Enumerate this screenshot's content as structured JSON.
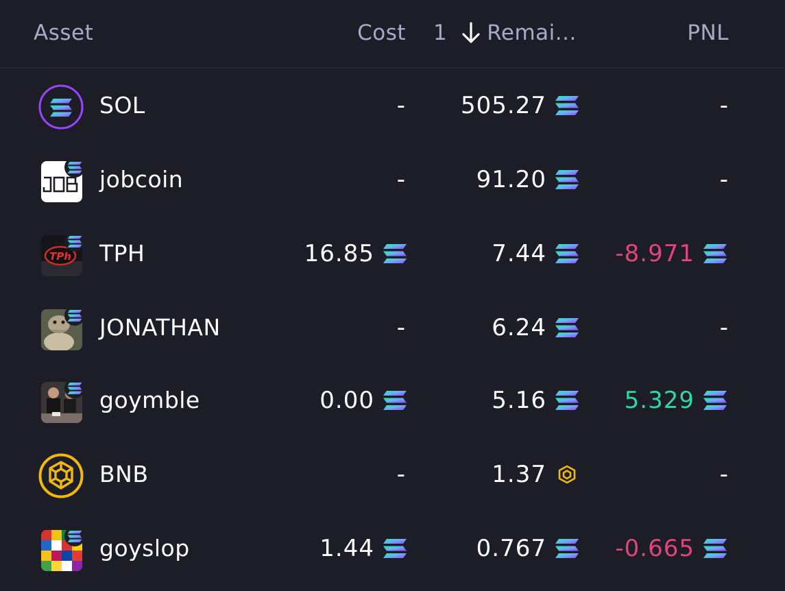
{
  "header": {
    "asset_label": "Asset",
    "cost_label": "Cost",
    "sort_number": "1",
    "remaining_label": "Remai...",
    "pnl_label": "PNL"
  },
  "colors": {
    "background": "#1c1d26",
    "header_text": "#a8aac7",
    "negative": "#e0457b",
    "positive": "#2fd8a5",
    "bnb": "#f0b90b",
    "sol_purple": "#9945ff"
  },
  "rows": [
    {
      "name": "SOL",
      "avatar": "sol-logo",
      "cost": "-",
      "remaining": "505.27",
      "remaining_unit": "sol-icon",
      "pnl": "-",
      "pnl_sign": "none"
    },
    {
      "name": "jobcoin",
      "avatar": "jobcoin-logo",
      "cost": "-",
      "remaining": "91.20",
      "remaining_unit": "sol-icon",
      "pnl": "-",
      "pnl_sign": "none"
    },
    {
      "name": "TPH",
      "avatar": "tph-logo",
      "cost": "16.85",
      "remaining": "7.44",
      "remaining_unit": "sol-icon",
      "pnl": "-8.971",
      "pnl_sign": "negative"
    },
    {
      "name": "JONATHAN",
      "avatar": "jonathan-logo",
      "cost": "-",
      "remaining": "6.24",
      "remaining_unit": "sol-icon",
      "pnl": "-",
      "pnl_sign": "none"
    },
    {
      "name": "goymble",
      "avatar": "goymble-logo",
      "cost": "0.00",
      "remaining": "5.16",
      "remaining_unit": "sol-icon",
      "pnl": "5.329",
      "pnl_sign": "positive"
    },
    {
      "name": "BNB",
      "avatar": "bnb-logo",
      "cost": "-",
      "remaining": "1.37",
      "remaining_unit": "bnb-icon",
      "pnl": "-",
      "pnl_sign": "none"
    },
    {
      "name": "goyslop",
      "avatar": "goyslop-logo",
      "cost": "1.44",
      "remaining": "0.767",
      "remaining_unit": "sol-icon",
      "pnl": "-0.665",
      "pnl_sign": "negative"
    }
  ]
}
